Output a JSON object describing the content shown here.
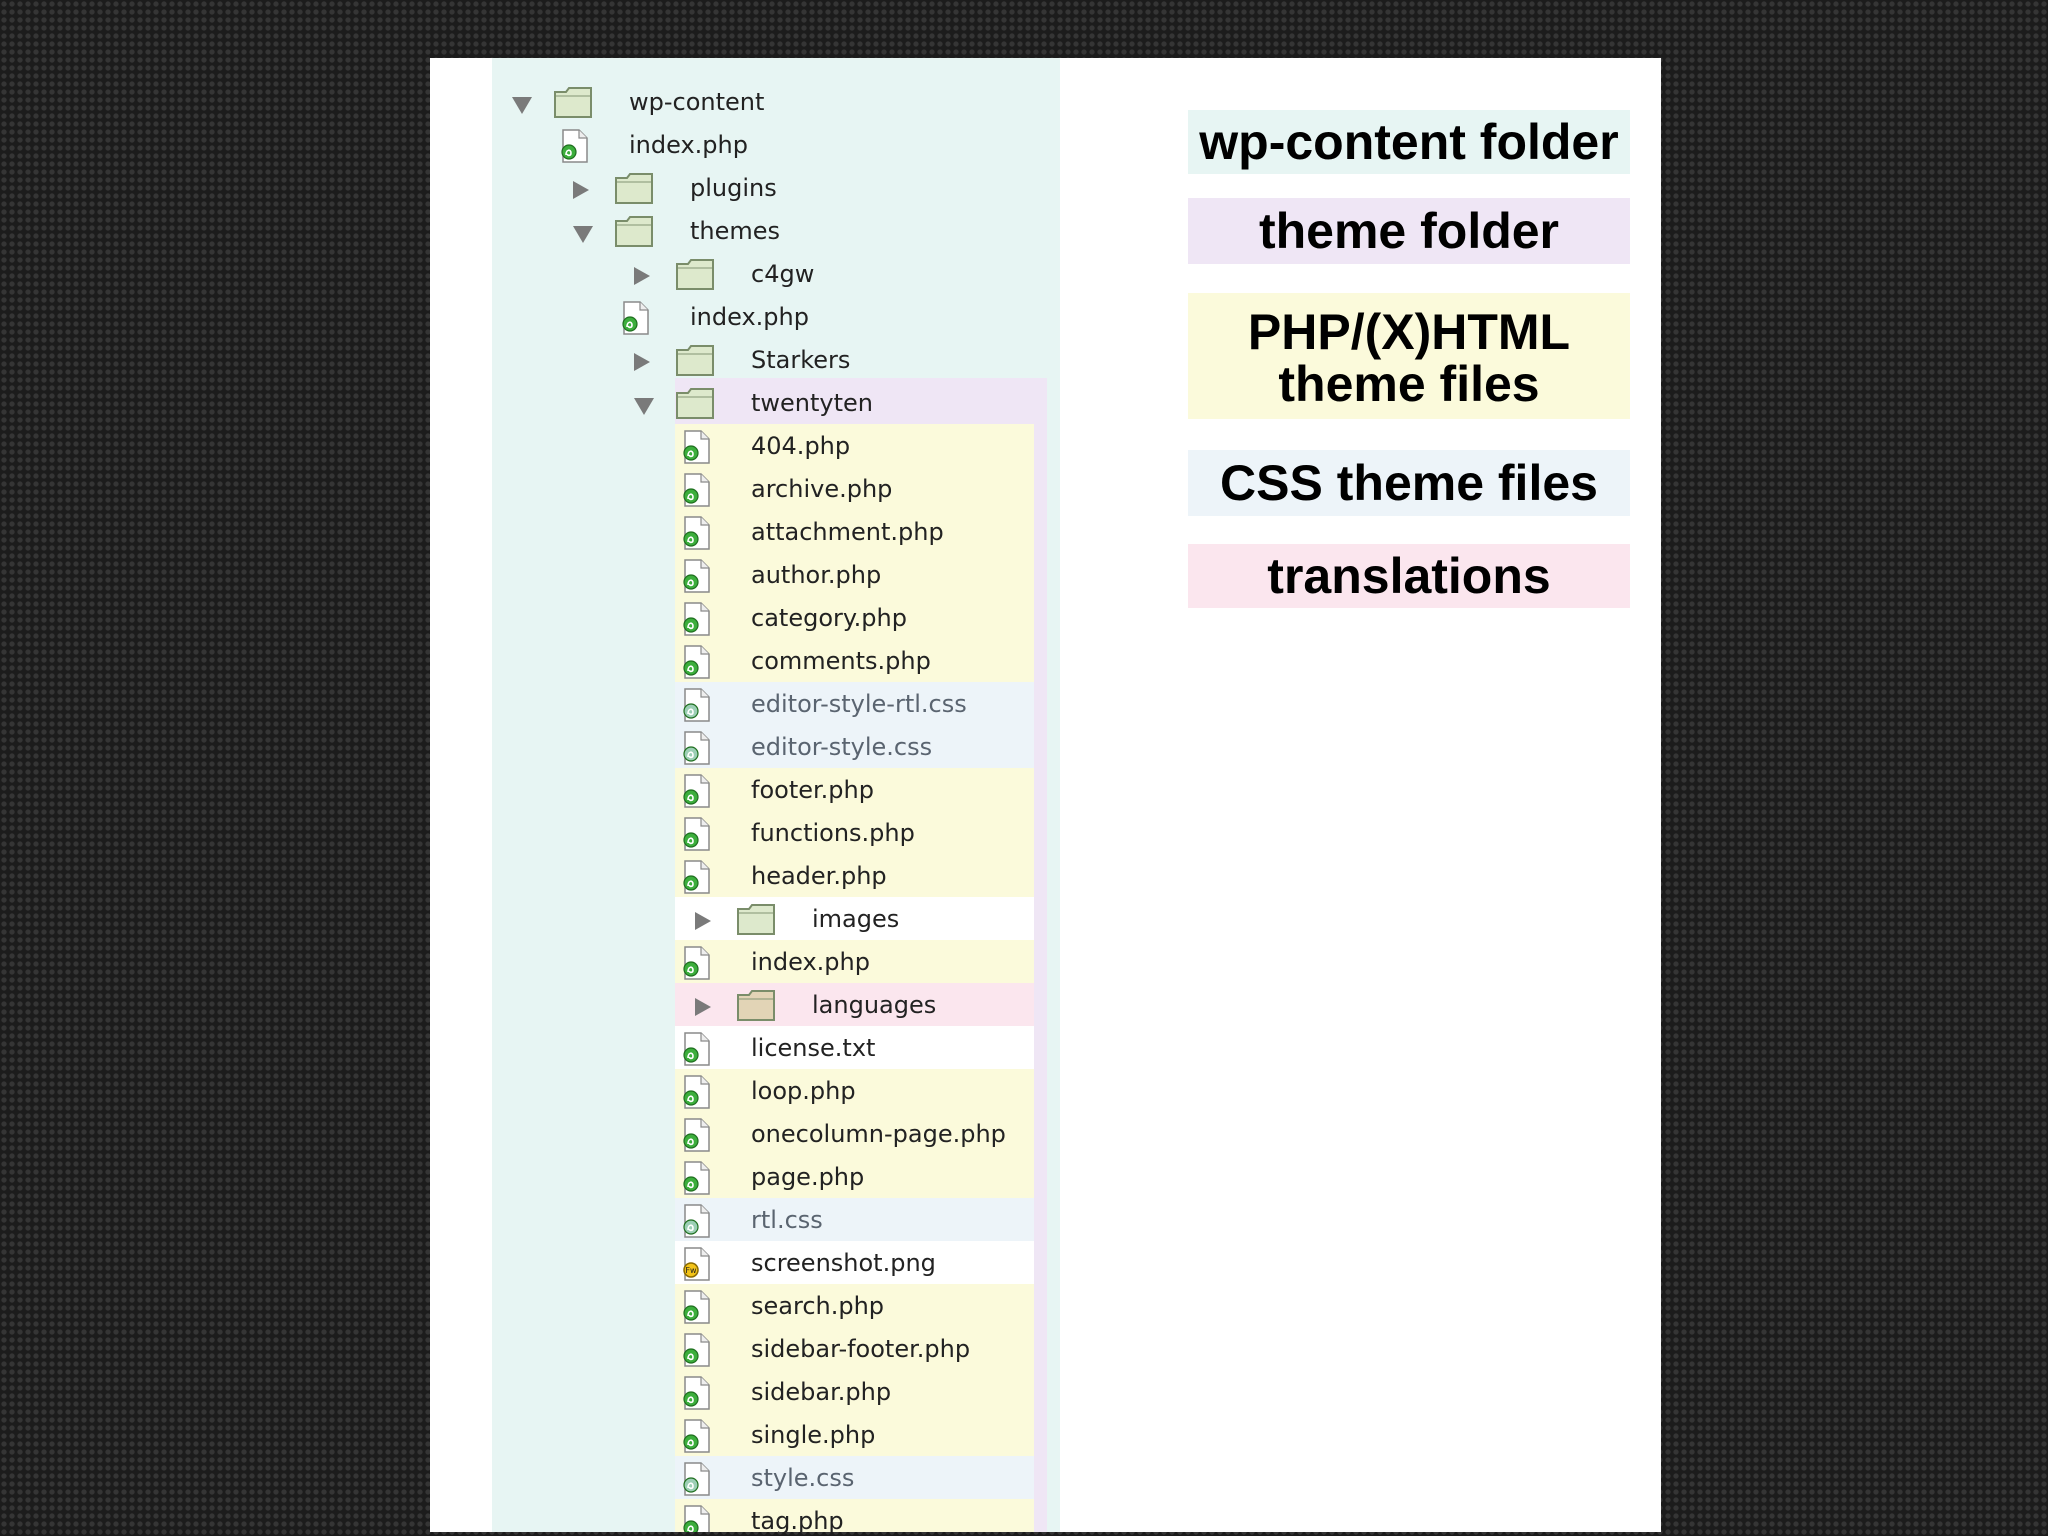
{
  "colors": {
    "background": "#1c1c1c",
    "tree_panel": "#e7f5f3",
    "theme_folder": "#efe6f5",
    "php_files": "#fbfadb",
    "css_files": "#edf4f9",
    "translations": "#fbe6ee",
    "other": "#ffffff"
  },
  "tree": {
    "rows": [
      {
        "label": "wp-content",
        "type": "folder",
        "toggle": "expanded",
        "depth": 0,
        "category": "wp-content"
      },
      {
        "label": "index.php",
        "type": "php",
        "toggle": "none",
        "depth": 1,
        "category": "wp-content"
      },
      {
        "label": "plugins",
        "type": "folder",
        "toggle": "collapsed",
        "depth": 1,
        "category": "wp-content"
      },
      {
        "label": "themes",
        "type": "folder",
        "toggle": "expanded",
        "depth": 1,
        "category": "wp-content"
      },
      {
        "label": "c4gw",
        "type": "folder",
        "toggle": "collapsed",
        "depth": 2,
        "category": "wp-content"
      },
      {
        "label": "index.php",
        "type": "php",
        "toggle": "none",
        "depth": 2,
        "category": "wp-content"
      },
      {
        "label": "Starkers",
        "type": "folder",
        "toggle": "collapsed",
        "depth": 2,
        "category": "wp-content"
      },
      {
        "label": "twentyten",
        "type": "folder",
        "toggle": "expanded",
        "depth": 2,
        "category": "theme"
      },
      {
        "label": "404.php",
        "type": "php",
        "toggle": "none",
        "depth": 3,
        "category": "php"
      },
      {
        "label": "archive.php",
        "type": "php",
        "toggle": "none",
        "depth": 3,
        "category": "php"
      },
      {
        "label": "attachment.php",
        "type": "php",
        "toggle": "none",
        "depth": 3,
        "category": "php"
      },
      {
        "label": "author.php",
        "type": "php",
        "toggle": "none",
        "depth": 3,
        "category": "php"
      },
      {
        "label": "category.php",
        "type": "php",
        "toggle": "none",
        "depth": 3,
        "category": "php"
      },
      {
        "label": "comments.php",
        "type": "php",
        "toggle": "none",
        "depth": 3,
        "category": "php"
      },
      {
        "label": "editor-style-rtl.css",
        "type": "css",
        "toggle": "none",
        "depth": 3,
        "category": "css"
      },
      {
        "label": "editor-style.css",
        "type": "css",
        "toggle": "none",
        "depth": 3,
        "category": "css"
      },
      {
        "label": "footer.php",
        "type": "php",
        "toggle": "none",
        "depth": 3,
        "category": "php"
      },
      {
        "label": "functions.php",
        "type": "php",
        "toggle": "none",
        "depth": 3,
        "category": "php"
      },
      {
        "label": "header.php",
        "type": "php",
        "toggle": "none",
        "depth": 3,
        "category": "php"
      },
      {
        "label": "images",
        "type": "folder",
        "toggle": "collapsed",
        "depth": 3,
        "category": "other"
      },
      {
        "label": "index.php",
        "type": "php",
        "toggle": "none",
        "depth": 3,
        "category": "php"
      },
      {
        "label": "languages",
        "type": "folder",
        "toggle": "collapsed",
        "depth": 3,
        "category": "translations"
      },
      {
        "label": "license.txt",
        "type": "txt",
        "toggle": "none",
        "depth": 3,
        "category": "other"
      },
      {
        "label": "loop.php",
        "type": "php",
        "toggle": "none",
        "depth": 3,
        "category": "php"
      },
      {
        "label": "onecolumn-page.php",
        "type": "php",
        "toggle": "none",
        "depth": 3,
        "category": "php"
      },
      {
        "label": "page.php",
        "type": "php",
        "toggle": "none",
        "depth": 3,
        "category": "php"
      },
      {
        "label": "rtl.css",
        "type": "css",
        "toggle": "none",
        "depth": 3,
        "category": "css"
      },
      {
        "label": "screenshot.png",
        "type": "png",
        "toggle": "none",
        "depth": 3,
        "category": "other"
      },
      {
        "label": "search.php",
        "type": "php",
        "toggle": "none",
        "depth": 3,
        "category": "php"
      },
      {
        "label": "sidebar-footer.php",
        "type": "php",
        "toggle": "none",
        "depth": 3,
        "category": "php"
      },
      {
        "label": "sidebar.php",
        "type": "php",
        "toggle": "none",
        "depth": 3,
        "category": "php"
      },
      {
        "label": "single.php",
        "type": "php",
        "toggle": "none",
        "depth": 3,
        "category": "php"
      },
      {
        "label": "style.css",
        "type": "css",
        "toggle": "none",
        "depth": 3,
        "category": "css"
      },
      {
        "label": "tag.php",
        "type": "php",
        "toggle": "none",
        "depth": 3,
        "category": "php"
      }
    ]
  },
  "legend": {
    "wp_content": "wp-content folder",
    "theme_folder": "theme folder",
    "php_line1": "PHP/(X)HTML",
    "php_line2": "theme files",
    "css": "CSS theme files",
    "translations": "translations"
  }
}
